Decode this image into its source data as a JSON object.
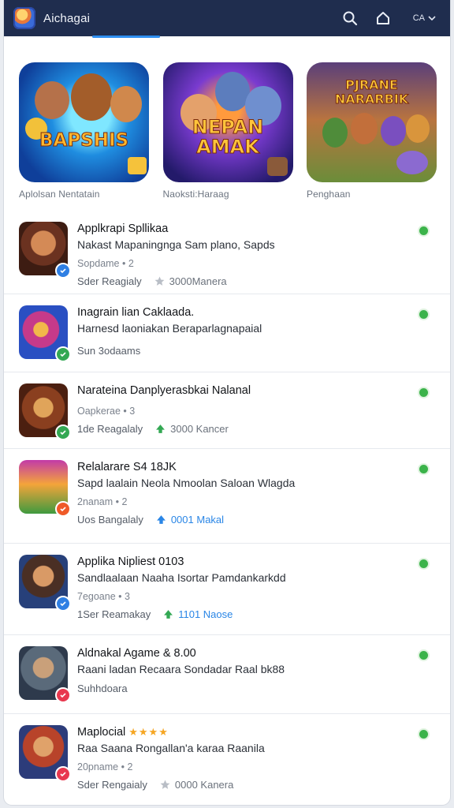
{
  "header": {
    "title": "Aichagai",
    "search_icon": "search-icon",
    "home_icon": "home-icon",
    "language": "CA",
    "accent": "#2e8ef0",
    "bar_color": "#1f2d4e"
  },
  "featured": [
    {
      "caption": "Aplolsan Nentatain",
      "art_text": "BAPSHIS"
    },
    {
      "caption": "Naoksti:Haraag",
      "art_text": "NEPAN AMAK"
    },
    {
      "caption": "Penghaan",
      "art_text": "PJRANE NARARBIK"
    }
  ],
  "apps": [
    {
      "name": "Applkrapi Spllikaa",
      "desc": "Nakast Mapaningnga Sam plano, Sapds",
      "meta1": "Sopdame • 2",
      "meta2": "Sder Reagialy",
      "stat": "3000Manera",
      "badge_color": "#2f7fe3"
    },
    {
      "name": "Inagrain lian Caklaada.",
      "desc": "Harnesd laoniakan Beraparlagnapaial",
      "meta1": "",
      "meta2": "Sun 3odaams",
      "stat": "",
      "badge_color": "#33a853"
    },
    {
      "name": "Narateina Danplyerasbkai Nalanal",
      "desc": "",
      "meta1": "Oapkerae • 3",
      "meta2": "1de Reagalaly",
      "stat": "3000 Kancer",
      "badge_color": "#33a853"
    },
    {
      "name": "Relalarare S4 18JK",
      "desc": "Sapd laalain Neola Nmoolan Saloan Wlagda",
      "meta1": "2nanam • 2",
      "meta2": "Uos Bangalaly",
      "stat": "0001 Makal",
      "badge_color": "#ef5a28"
    },
    {
      "name": "Applika Nipliest 0103",
      "desc": "Sandlaalaan Naaha Isortar Pamdankarkdd",
      "meta1": "7egoane • 3",
      "meta2": "1Ser Reamakay",
      "stat": "1101 Naose",
      "badge_color": "#2f7fe3"
    },
    {
      "name": "Aldnakal Agame & 8.00",
      "desc": "Raani ladan Recaara Sondadar Raal bk88",
      "meta1": "",
      "meta2": "Suhhdoara",
      "stat": "",
      "badge_color": "#e8384f"
    },
    {
      "name": "Maplocial",
      "desc": "Raa Saana Rongallan'a karaa Raanila",
      "meta1": "20pname • 2",
      "meta2": "Sder Rengaialy",
      "stat": "0000 Kanera",
      "badge_color": "#e8384f"
    }
  ]
}
